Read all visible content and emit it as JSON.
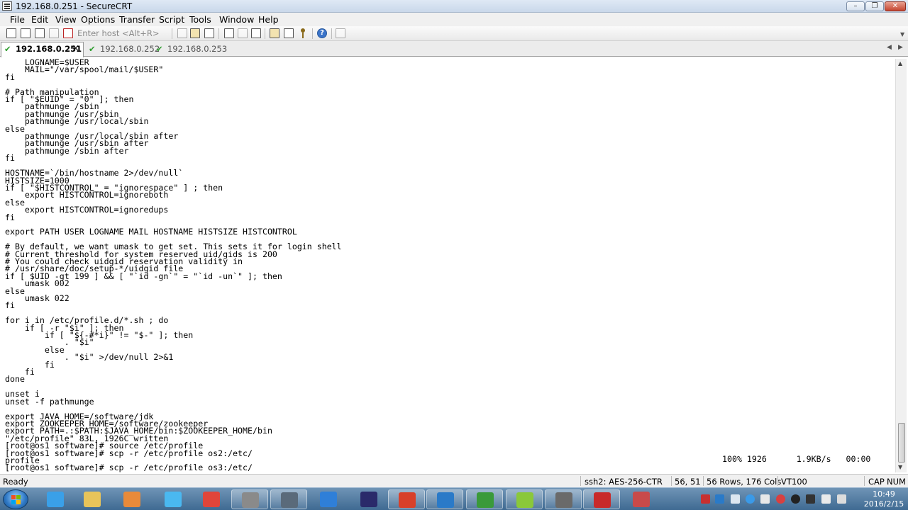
{
  "window": {
    "title": "192.168.0.251 - SecureCRT",
    "minimize_glyph": "–",
    "maximize_glyph": "❐",
    "close_glyph": "✕"
  },
  "menu": {
    "items": [
      "File",
      "Edit",
      "View",
      "Options",
      "Transfer",
      "Script",
      "Tools",
      "Window",
      "Help"
    ]
  },
  "toolbar": {
    "quick_connect_placeholder": "Enter host <Alt+R>",
    "icons": [
      "connect-icon",
      "quick-connect-icon",
      "connect-tab-icon",
      "reconnect-icon",
      "disconnect-icon",
      "copy-icon",
      "paste-icon",
      "find-icon",
      "print-icon",
      "print-selection-icon",
      "print-setup-icon",
      "session-options-icon",
      "global-options-icon",
      "keymap-icon",
      "help-icon",
      "script-icon"
    ]
  },
  "tabs": [
    {
      "label": "192.168.0.251",
      "active": true,
      "close": "×"
    },
    {
      "label": "192.168.0.252",
      "active": false
    },
    {
      "label": "192.168.0.253",
      "active": false
    }
  ],
  "terminal": {
    "lines": [
      "    LOGNAME=$USER",
      "    MAIL=\"/var/spool/mail/$USER\"",
      "fi",
      "",
      "# Path manipulation",
      "if [ \"$EUID\" = \"0\" ]; then",
      "    pathmunge /sbin",
      "    pathmunge /usr/sbin",
      "    pathmunge /usr/local/sbin",
      "else",
      "    pathmunge /usr/local/sbin after",
      "    pathmunge /usr/sbin after",
      "    pathmunge /sbin after",
      "fi",
      "",
      "HOSTNAME=`/bin/hostname 2>/dev/null`",
      "HISTSIZE=1000",
      "if [ \"$HISTCONTROL\" = \"ignorespace\" ] ; then",
      "    export HISTCONTROL=ignoreboth",
      "else",
      "    export HISTCONTROL=ignoredups",
      "fi",
      "",
      "export PATH USER LOGNAME MAIL HOSTNAME HISTSIZE HISTCONTROL",
      "",
      "# By default, we want umask to get set. This sets it for login shell",
      "# Current threshold for system reserved uid/gids is 200",
      "# You could check uidgid reservation validity in",
      "# /usr/share/doc/setup-*/uidgid file",
      "if [ $UID -gt 199 ] && [ \"`id -gn`\" = \"`id -un`\" ]; then",
      "    umask 002",
      "else",
      "    umask 022",
      "fi",
      "",
      "for i in /etc/profile.d/*.sh ; do",
      "    if [ -r \"$i\" ]; then",
      "        if [ \"${-#*i}\" != \"$-\" ]; then",
      "            . \"$i\"",
      "        else",
      "            . \"$i\" >/dev/null 2>&1",
      "        fi",
      "    fi",
      "done",
      "",
      "unset i",
      "unset -f pathmunge",
      "",
      "export JAVA_HOME=/software/jdk",
      "export ZOOKEEPER_HOME=/software/zookeeper",
      "export PATH=.:$PATH:$JAVA_HOME/bin:$ZOOKEEPER_HOME/bin",
      "\"/etc/profile\" 83L, 1926C written",
      "[root@os1 software]# source /etc/profile",
      "[root@os1 software]# scp -r /etc/profile os2:/etc/",
      "profile",
      "[root@os1 software]# scp -r /etc/profile os3:/etc/"
    ],
    "transfer_status": "100% 1926      1.9KB/s   00:00"
  },
  "statusbar": {
    "ready": "Ready",
    "cipher": "ssh2: AES-256-CTR",
    "cursor": "56,  51",
    "size": "56 Rows, 176 Cols",
    "emulation": "VT100",
    "caps": "CAP",
    "num": "NUM"
  },
  "taskbar": {
    "time": "10:49",
    "date": "2016/2/15",
    "apps": [
      {
        "name": "ie-icon",
        "color": "#3aa0e8",
        "open": false
      },
      {
        "name": "folder-icon",
        "color": "#e8c45a",
        "open": false
      },
      {
        "name": "media-player-icon",
        "color": "#e88a3a",
        "open": false
      },
      {
        "name": "network-icon",
        "color": "#4ab8f0",
        "open": false
      },
      {
        "name": "chrome-icon",
        "color": "#e0453a",
        "open": false
      },
      {
        "name": "securecrt-icon",
        "color": "#8a8a8a",
        "open": true
      },
      {
        "name": "securefx-icon",
        "color": "#5a6a7a",
        "open": true
      },
      {
        "name": "feather-icon",
        "color": "#2f7fd8",
        "open": false
      },
      {
        "name": "eclipse-icon",
        "color": "#2a2a6a",
        "open": false
      },
      {
        "name": "filezilla-icon",
        "color": "#d8402a",
        "open": true
      },
      {
        "name": "outlook-icon",
        "color": "#2a7ac8",
        "open": true
      },
      {
        "name": "project-icon",
        "color": "#3a9a3a",
        "open": true
      },
      {
        "name": "mindmanager-icon",
        "color": "#8ac83a",
        "open": true
      },
      {
        "name": "virtual-machine-icon",
        "color": "#6a6a6a",
        "open": true
      },
      {
        "name": "xmind-icon",
        "color": "#c82a2a",
        "open": true
      },
      {
        "name": "paint-icon",
        "color": "#c84a4a",
        "open": false
      }
    ]
  }
}
